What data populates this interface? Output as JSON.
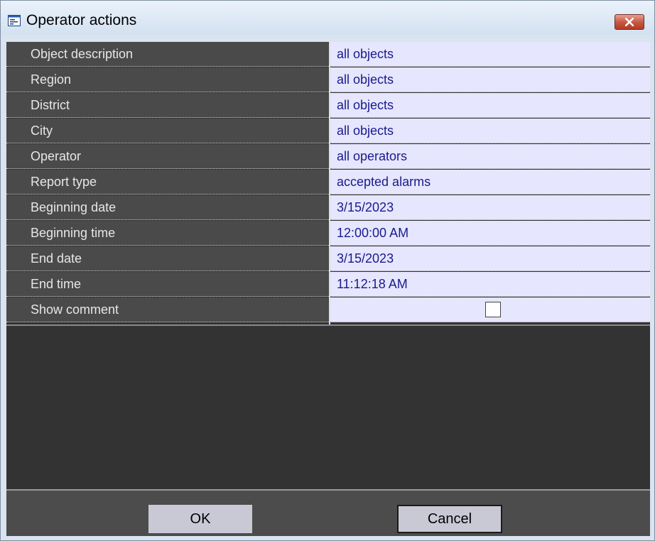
{
  "window": {
    "title": "Operator actions"
  },
  "properties": [
    {
      "label": "Object description",
      "value": "all objects"
    },
    {
      "label": "Region",
      "value": "all objects"
    },
    {
      "label": "District",
      "value": "all objects"
    },
    {
      "label": "City",
      "value": "all objects"
    },
    {
      "label": "Operator",
      "value": "all operators"
    },
    {
      "label": "Report type",
      "value": "accepted alarms"
    },
    {
      "label": "Beginning date",
      "value": "3/15/2023"
    },
    {
      "label": "Beginning time",
      "value": "12:00:00 AM"
    },
    {
      "label": "End date",
      "value": "3/15/2023"
    },
    {
      "label": "End time",
      "value": "11:12:18 AM"
    },
    {
      "label": "Show comment",
      "checked": false
    }
  ],
  "buttons": {
    "ok": "OK",
    "cancel": "Cancel"
  },
  "icons": {
    "title": "dialog-window-icon",
    "close": "close-icon"
  }
}
